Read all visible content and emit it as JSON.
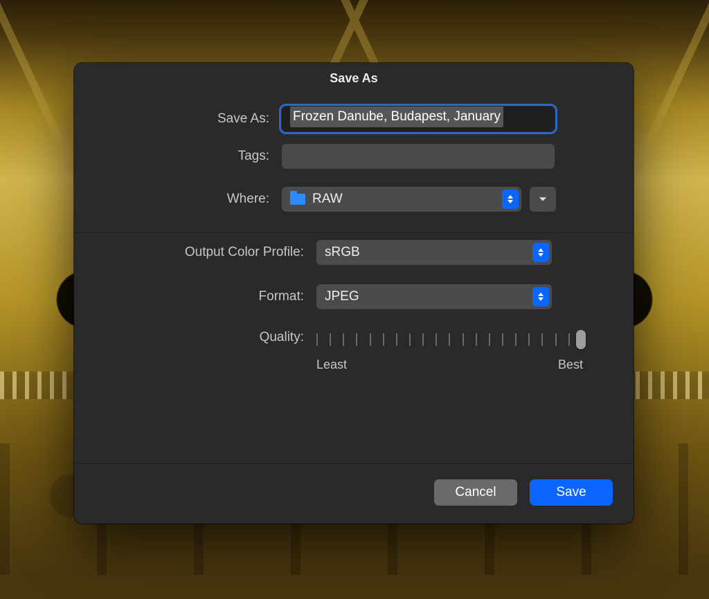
{
  "dialog": {
    "title": "Save As",
    "saveas_label": "Save As:",
    "filename": "Frozen Danube, Budapest, January",
    "tags_label": "Tags:",
    "tags_value": "",
    "where_label": "Where:",
    "where_folder": "RAW",
    "profile_label": "Output Color Profile:",
    "profile_value": "sRGB",
    "format_label": "Format:",
    "format_value": "JPEG",
    "quality_label": "Quality:",
    "quality_min_label": "Least",
    "quality_max_label": "Best",
    "cancel_label": "Cancel",
    "save_label": "Save"
  }
}
